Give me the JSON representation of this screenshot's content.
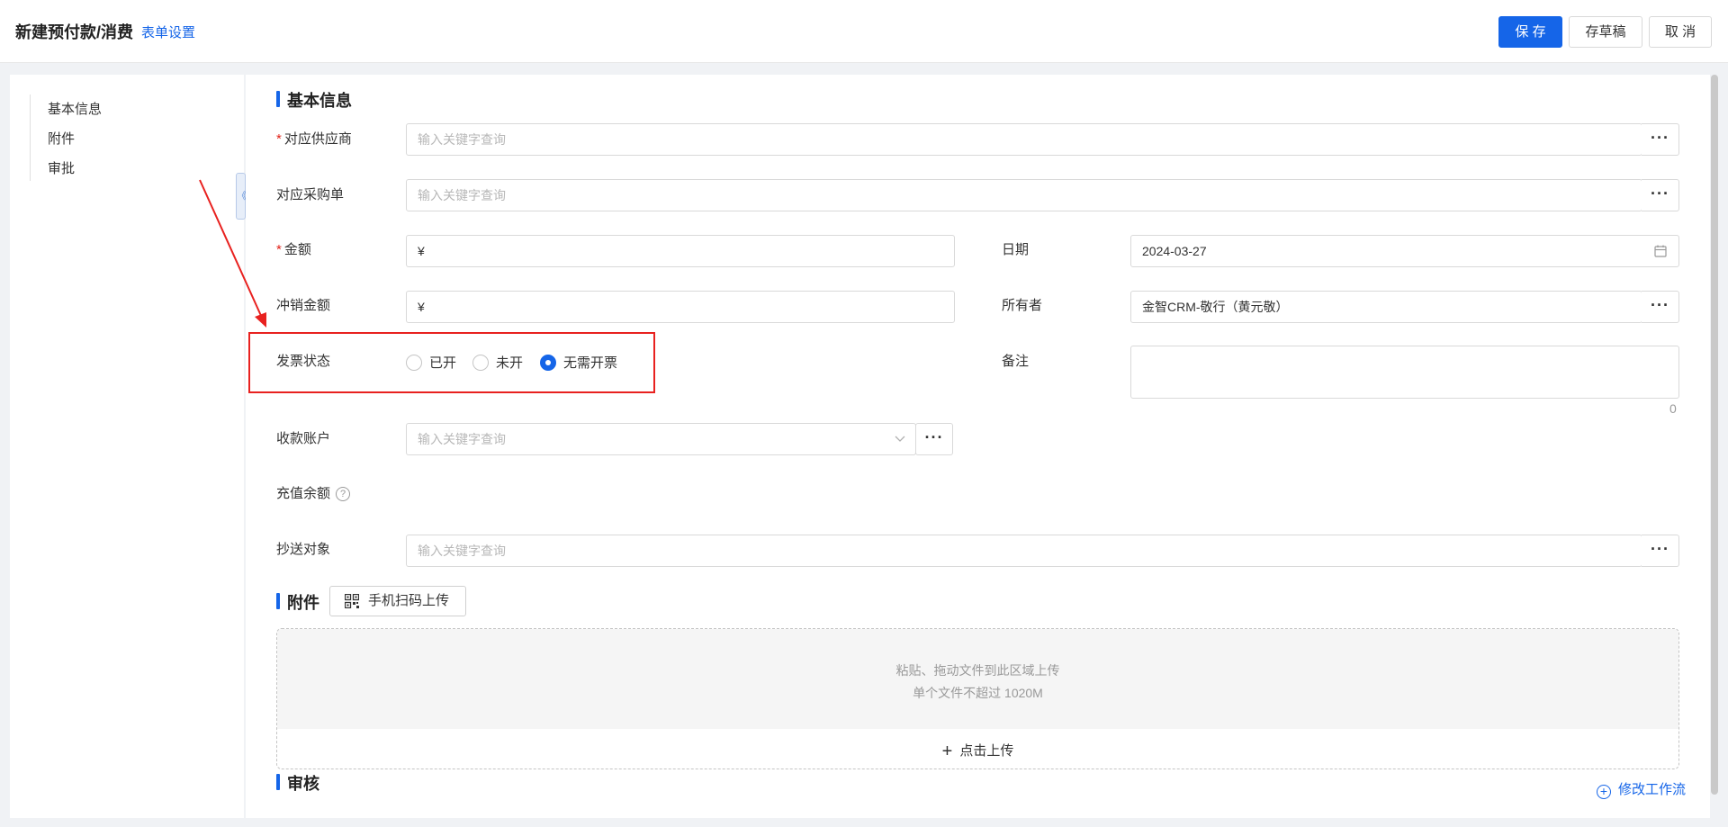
{
  "header": {
    "title": "新建预付款/消费",
    "form_settings": "表单设置",
    "save": "保 存",
    "save_draft": "存草稿",
    "cancel": "取 消"
  },
  "sidebar": {
    "items": [
      {
        "label": "基本信息"
      },
      {
        "label": "附件"
      },
      {
        "label": "审批"
      }
    ],
    "collapse_glyph": "《"
  },
  "basic_info": {
    "section_title": "基本信息",
    "supplier": {
      "label": "对应供应商",
      "required": "*",
      "placeholder": "输入关键字查询"
    },
    "purchase_order": {
      "label": "对应采购单",
      "placeholder": "输入关键字查询"
    },
    "amount": {
      "label": "金额",
      "required": "*",
      "value": "¥"
    },
    "date": {
      "label": "日期",
      "value": "2024-03-27"
    },
    "writeoff_amount": {
      "label": "冲销金额",
      "value": "¥"
    },
    "owner": {
      "label": "所有者",
      "value": "金智CRM-敬行（黄元敬）"
    },
    "invoice_status": {
      "label": "发票状态",
      "options": [
        "已开",
        "未开",
        "无需开票"
      ],
      "selected": "无需开票"
    },
    "remark": {
      "label": "备注",
      "count": "0"
    },
    "receiving_account": {
      "label": "收款账户",
      "placeholder": "输入关键字查询"
    },
    "recharge_balance": {
      "label": "充值余额",
      "help": "?"
    },
    "cc": {
      "label": "抄送对象",
      "placeholder": "输入关键字查询"
    },
    "more_glyph": "···"
  },
  "attachments": {
    "section_title": "附件",
    "scan_upload": "手机扫码上传",
    "drop_hint_1": "粘贴、拖动文件到此区域上传",
    "drop_hint_2": "单个文件不超过 1020M",
    "click_upload": "点击上传",
    "plus": "+"
  },
  "review": {
    "section_title": "审核",
    "modify_workflow": "修改工作流",
    "plus": "+"
  },
  "colors": {
    "primary": "#1565e8",
    "required": "#e2231a",
    "annotation": "#e8211f"
  }
}
